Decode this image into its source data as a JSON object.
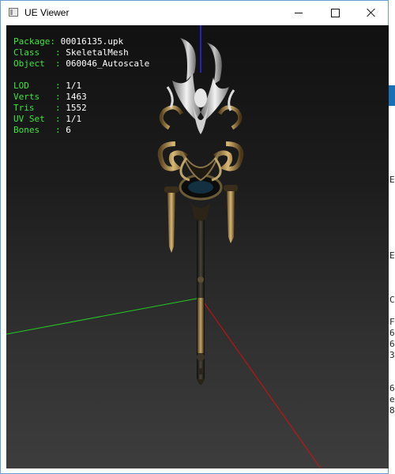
{
  "window": {
    "title": "UE Viewer",
    "controls": {
      "minimize": "minimize",
      "maximize": "maximize",
      "close": "close"
    }
  },
  "info_panel": {
    "package": {
      "label": "Package",
      "value": "00016135.upk"
    },
    "class": {
      "label": "Class",
      "value": "SkeletalMesh"
    },
    "object": {
      "label": "Object",
      "value": "060046_Autoscale"
    },
    "lod": {
      "label": "LOD",
      "value": "1/1"
    },
    "verts": {
      "label": "Verts",
      "value": "1463"
    },
    "tris": {
      "label": "Tris",
      "value": "1552"
    },
    "uv_set": {
      "label": "UV Set",
      "value": "1/1"
    },
    "bones": {
      "label": "Bones",
      "value": "6"
    }
  },
  "background_window": {
    "fragments": [
      "E",
      "E",
      "C",
      "F",
      "6",
      "6",
      "3",
      "6",
      "e",
      "8"
    ]
  },
  "colors": {
    "info_key": "#3ee63e",
    "info_value": "#ffffff",
    "axis_x": "#ff2020",
    "axis_y": "#22cc22",
    "axis_z": "#2a2aff",
    "viewport_top": "#111111",
    "viewport_bottom": "#3d3d3d"
  }
}
